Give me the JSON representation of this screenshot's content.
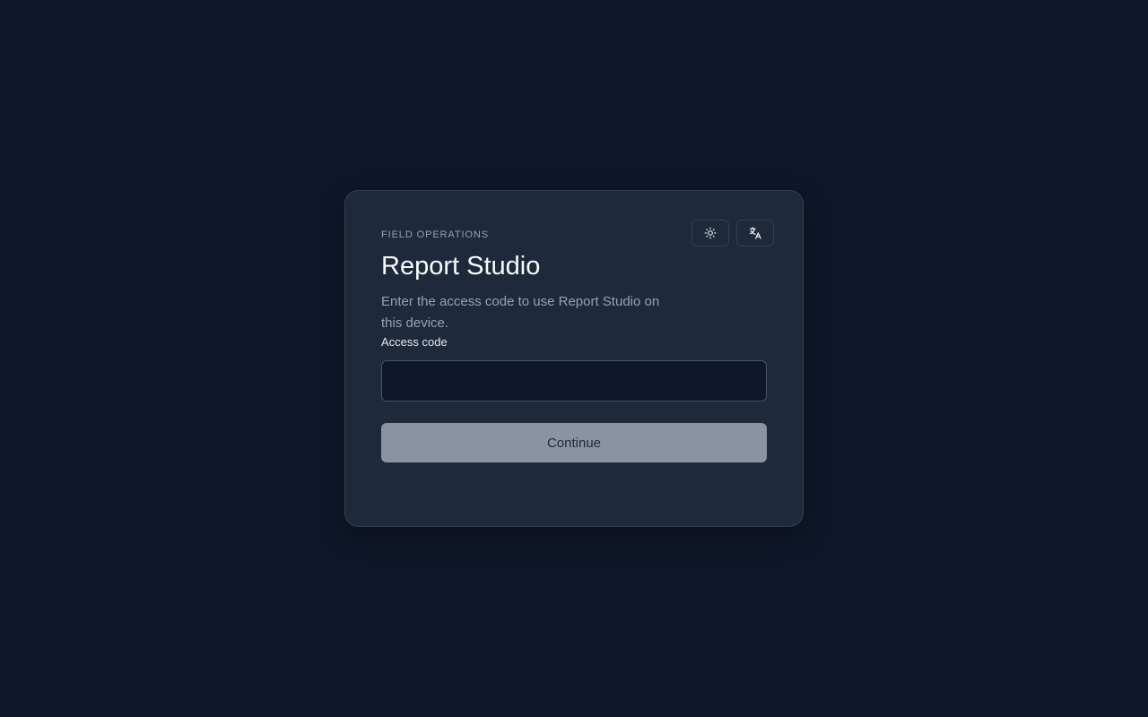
{
  "card": {
    "eyebrow": "FIELD OPERATIONS",
    "title": "Report Studio",
    "subtitle": "Enter the access code to use Report Studio on this device."
  },
  "form": {
    "access_code_label": "Access code",
    "access_code_value": "",
    "access_code_placeholder": "",
    "continue_label": "Continue",
    "continue_disabled": true
  },
  "toolbar": {
    "theme_icon": "sun-icon",
    "language_icon": "translate-icon"
  },
  "colors": {
    "background": "#0f172a",
    "card": "#1e293b",
    "border": "#334155",
    "muted_text": "#94a3b8",
    "disabled_button": "#8a93a1"
  }
}
